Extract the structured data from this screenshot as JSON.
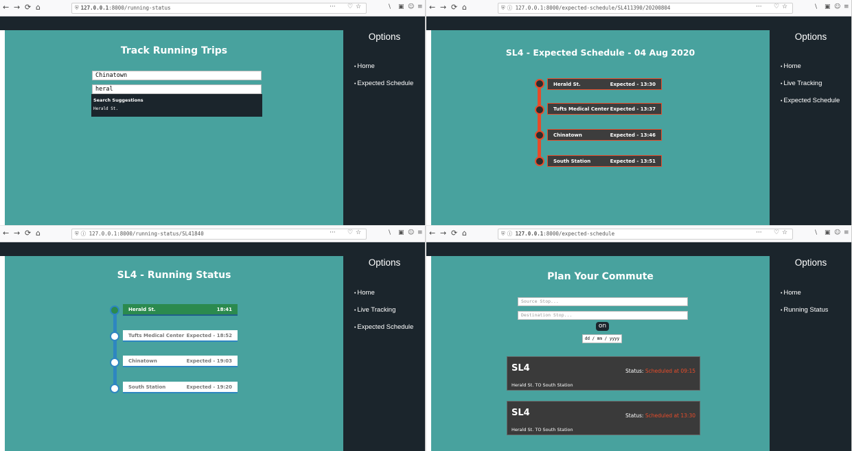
{
  "toolbar_icons": {
    "back": "←",
    "forward": "→",
    "reload": "⟳",
    "home": "⌂",
    "shield": "⛨",
    "info": "ⓘ",
    "more": "···",
    "pocket": "♡",
    "star": "☆",
    "library": "\\",
    "sidebar": "▣",
    "account": "☺",
    "menu": "≡"
  },
  "win1": {
    "url_host": "127.0.0.1",
    "url_path": ":8000/running-status",
    "title": "Track Running Trips",
    "source_value": "Chinatown",
    "dest_value": "heral",
    "suggest_title": "Search Suggestions",
    "suggest_items": [
      "Herald St."
    ],
    "sidebar_title": "Options",
    "nav": [
      "Home",
      "Expected Schedule"
    ]
  },
  "win2": {
    "url_host": "127.0.0.1",
    "url_path": ":8000/expected-schedule/SL411390/20200804",
    "title": "SL4 - Expected Schedule - 04 Aug 2020",
    "stops": [
      {
        "name": "Herald St.",
        "time": "Expected - 13:30"
      },
      {
        "name": "Tufts Medical Center",
        "time": "Expected - 13:37"
      },
      {
        "name": "Chinatown",
        "time": "Expected - 13:46"
      },
      {
        "name": "South Station",
        "time": "Expected - 13:51"
      }
    ],
    "sidebar_title": "Options",
    "nav": [
      "Home",
      "Live Tracking",
      "Expected Schedule"
    ]
  },
  "win3": {
    "url_host": "127.0.0.1",
    "url_path": ":8000/running-status/SL41840",
    "title": "SL4 - Running Status",
    "stops": [
      {
        "name": "Herald St.",
        "time": "18:41"
      },
      {
        "name": "Tufts Medical Center",
        "time": "Expected - 18:52"
      },
      {
        "name": "Chinatown",
        "time": "Expected - 19:03"
      },
      {
        "name": "South Station",
        "time": "Expected - 19:20"
      }
    ],
    "sidebar_title": "Options",
    "nav": [
      "Home",
      "Live Tracking",
      "Expected Schedule"
    ]
  },
  "win4": {
    "url_host": "127.0.0.1",
    "url_path": ":8000/expected-schedule",
    "title": "Plan Your Commute",
    "source_placeholder": "Source Stop...",
    "dest_placeholder": "Destination Stop...",
    "on_label": "on",
    "date_placeholder": "dd / mm / yyyy",
    "trips": [
      {
        "route": "SL4",
        "status_label": "Status:",
        "status_value": "Scheduled at 09:15",
        "direction": "Herald St. TO South Station"
      },
      {
        "route": "SL4",
        "status_label": "Status:",
        "status_value": "Scheduled at 13:30",
        "direction": "Herald St. TO South Station"
      }
    ],
    "sidebar_title": "Options",
    "nav": [
      "Home",
      "Running Status"
    ]
  },
  "colors": {
    "teal": "#48a29e",
    "dark": "#1b252c",
    "red": "#e74c2a",
    "green": "#2b8a4e",
    "blue": "#2e86c1"
  }
}
